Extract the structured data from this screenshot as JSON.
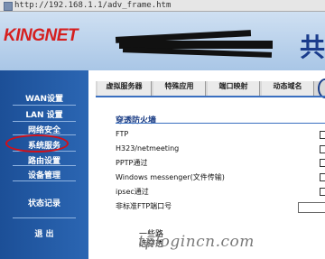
{
  "browser": {
    "url": "http://192.168.1.1/adv_frame.htm"
  },
  "banner": {
    "logo": "KINGNET",
    "right_glyph": "共"
  },
  "sidebar": {
    "items": [
      {
        "label": "WAN设置"
      },
      {
        "label": "LAN 设置"
      },
      {
        "label": "网络安全"
      },
      {
        "label": "系统服务",
        "highlighted": true
      },
      {
        "label": "路由设置"
      },
      {
        "label": "设备管理"
      },
      {
        "label": "状态记录"
      },
      {
        "label": "退  出"
      }
    ]
  },
  "tabs": [
    {
      "label": "虚拟服务器"
    },
    {
      "label": "特殊应用"
    },
    {
      "label": "端口映射"
    },
    {
      "label": "动态域名"
    }
  ],
  "section": {
    "title": "穿透防火墙",
    "rows": [
      {
        "label": "FTP"
      },
      {
        "label": "H323/netmeeting"
      },
      {
        "label": "PPTP通过"
      },
      {
        "label": "Windows messenger(文件传输)"
      },
      {
        "label": "ipsec通过"
      },
      {
        "label": "非标准FTP端口号"
      }
    ]
  },
  "note": {
    "line1": "一些路",
    "line2": "选穿透"
  },
  "watermark": "tplogincn.com",
  "colors": {
    "sidebar": "#2b66b3",
    "accent": "#1d3f86",
    "logo": "#d51f1f",
    "highlight_oval": "#d0101a"
  }
}
